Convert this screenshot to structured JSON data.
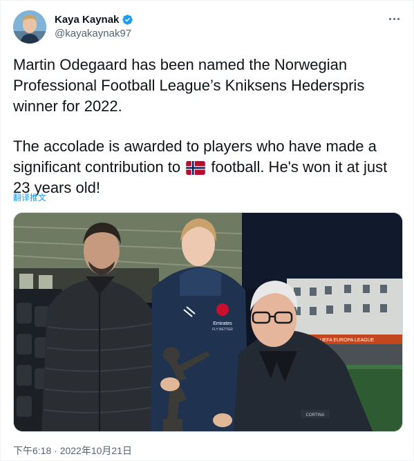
{
  "author": {
    "display_name": "Kaya Kaynak",
    "handle": "@kayakaynak97",
    "verified": true
  },
  "tweet": {
    "paragraph_1": "Martin Odegaard has been named the Norwegian Professional Football League’s Kniksens Hederspris winner for 2022.",
    "paragraph_2_before_flag": "The accolade is awarded to players who have made a significant contribution to",
    "paragraph_2_after_flag": "football. He's won it at just 23 years old!",
    "flag_icon": "norway-flag-icon",
    "translate_label": "翻译推文",
    "timestamp": "下午6:18 · 2022年10月21日"
  },
  "media": {
    "stand_sign": "UEFA EUROPA LEAGUE",
    "jacket_badge": "Emirates",
    "jacket_badge_sub": "FLY BETTER",
    "brand_text": "CORTINA"
  },
  "colors": {
    "accent": "#1d9bf0",
    "text_primary": "#0f1419",
    "text_secondary": "#536471",
    "border": "#cfd9de"
  },
  "icons": {
    "verified": "verified-badge-icon",
    "more": "more-options-icon"
  }
}
